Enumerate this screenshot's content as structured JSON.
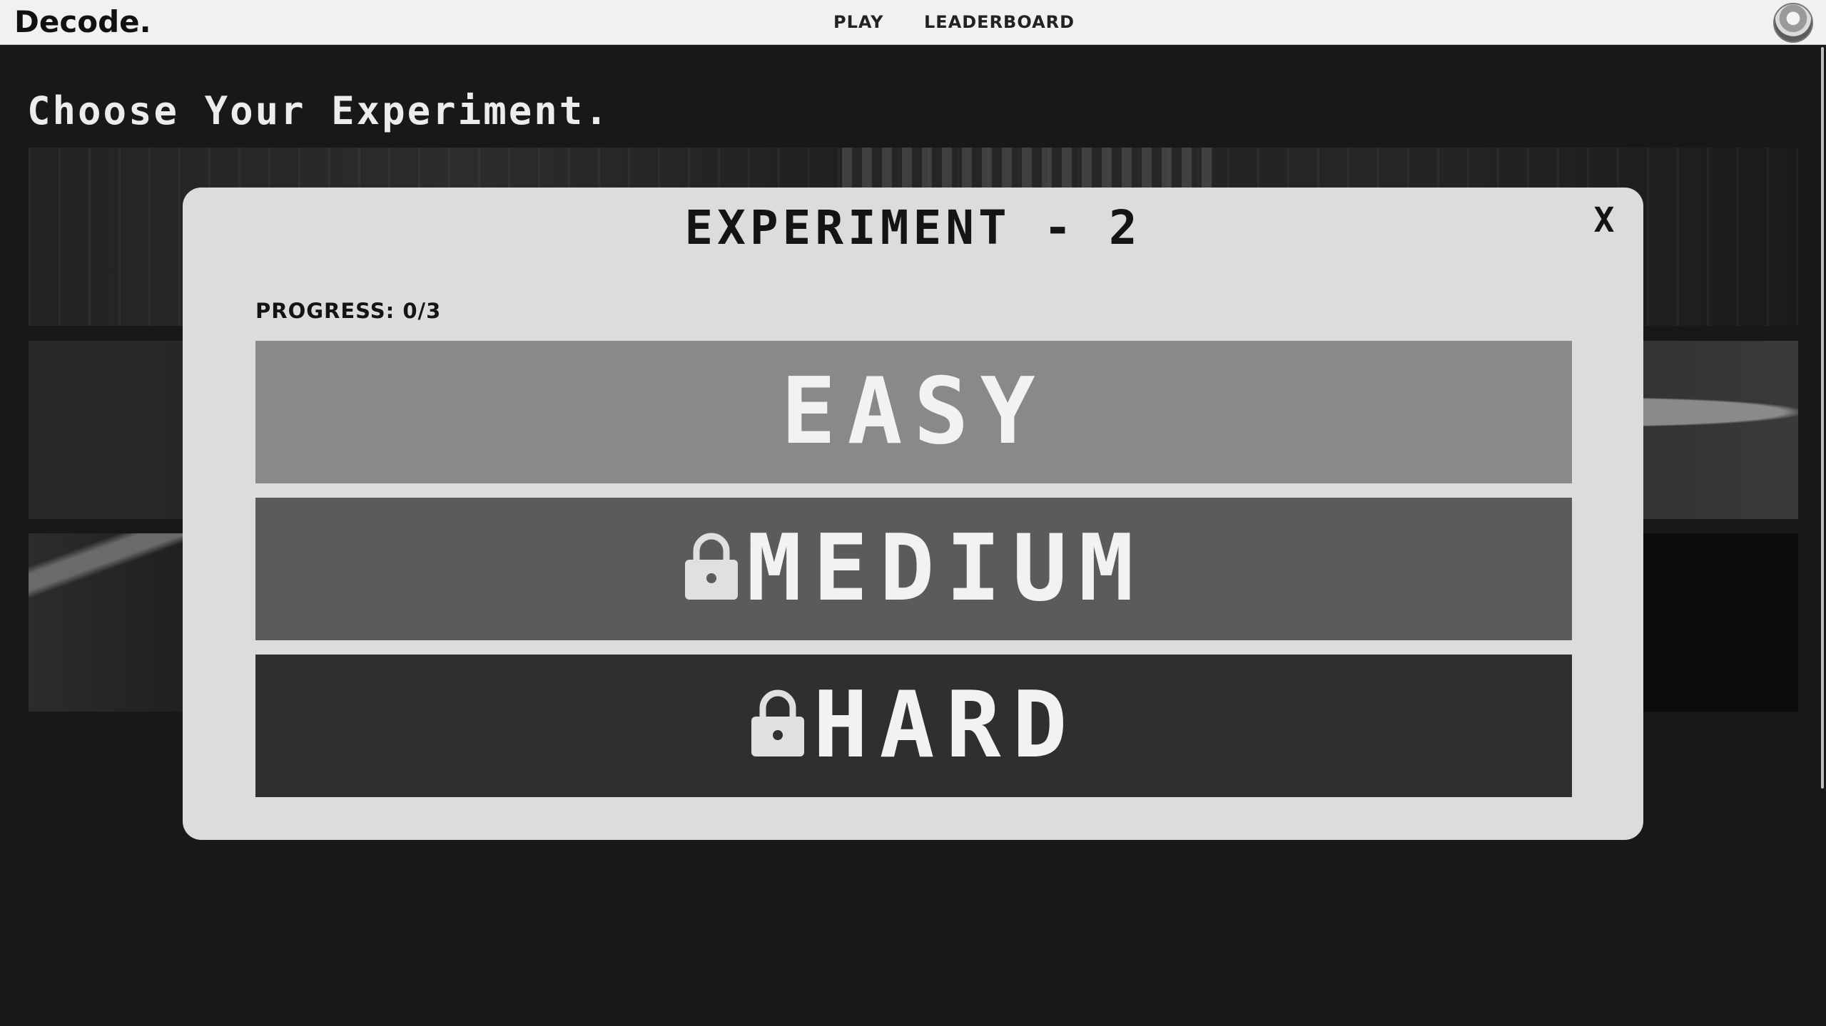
{
  "header": {
    "brand": "Decode.",
    "nav": [
      "PLAY",
      "LEADERBOARD"
    ],
    "avatar_icon": "user-avatar-icon"
  },
  "main": {
    "title": "Choose Your Experiment."
  },
  "modal": {
    "title": "EXPERIMENT - 2",
    "close_label": "X",
    "progress": "PROGRESS: 0/3",
    "levels": [
      {
        "label": "EASY",
        "locked": false,
        "color": "#898989"
      },
      {
        "label": "MEDIUM",
        "locked": true,
        "color": "#5b5b5b"
      },
      {
        "label": "HARD",
        "locked": true,
        "color": "#2f2f2f"
      }
    ]
  }
}
